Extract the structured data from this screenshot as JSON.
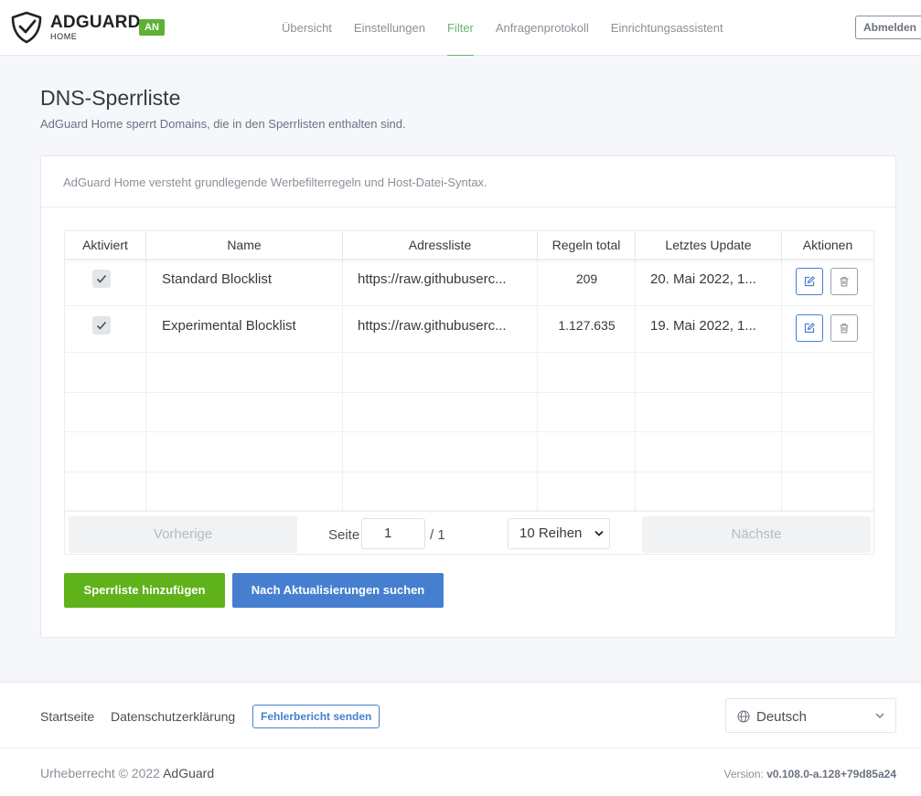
{
  "header": {
    "brand": "ADGUARD",
    "brand_sub": "HOME",
    "status_badge": "AN",
    "nav": [
      {
        "label": "Übersicht"
      },
      {
        "label": "Einstellungen"
      },
      {
        "label": "Filter"
      },
      {
        "label": "Anfragenprotokoll"
      },
      {
        "label": "Einrichtungsassistent"
      }
    ],
    "active_nav": "Filter",
    "logout_label": "Abmelden"
  },
  "page": {
    "title": "DNS-Sperrliste",
    "subtitle": "AdGuard Home sperrt Domains, die in den Sperrlisten enthalten sind."
  },
  "card": {
    "description": "AdGuard Home versteht grundlegende Werbefilterregeln und Host-Datei-Syntax."
  },
  "table": {
    "columns": [
      "Aktiviert",
      "Name",
      "Adressliste",
      "Regeln total",
      "Letztes Update",
      "Aktionen"
    ],
    "rows": [
      {
        "enabled": true,
        "name": "Standard Blocklist",
        "url": "https://raw.githubuserc...",
        "rules": "209",
        "updated": "20. Mai 2022, 1..."
      },
      {
        "enabled": true,
        "name": "Experimental Blocklist",
        "url": "https://raw.githubuserc...",
        "rules": "1.127.635",
        "updated": "19. Mai 2022, 1..."
      }
    ]
  },
  "pagination": {
    "prev_label": "Vorherige",
    "page_label": "Seite",
    "page_value": "1",
    "total_pages": "/ 1",
    "rows_option": "10 Reihen",
    "next_label": "Nächste"
  },
  "actions": {
    "add_label": "Sperrliste hinzufügen",
    "update_label": "Nach Aktualisierungen suchen"
  },
  "footer": {
    "links": [
      "Startseite",
      "Datenschutzerklärung"
    ],
    "report_label": "Fehlerbericht senden",
    "language": "Deutsch",
    "copyright_prefix": "Urheberrecht © 2022",
    "copyright_brand": "AdGuard",
    "version_label": "Version:",
    "version_value": "v0.108.0-a.128+79d85a24"
  },
  "colors": {
    "accent_green": "#5fb219",
    "accent_blue": "#467fcf",
    "nav_active": "#66b574"
  }
}
